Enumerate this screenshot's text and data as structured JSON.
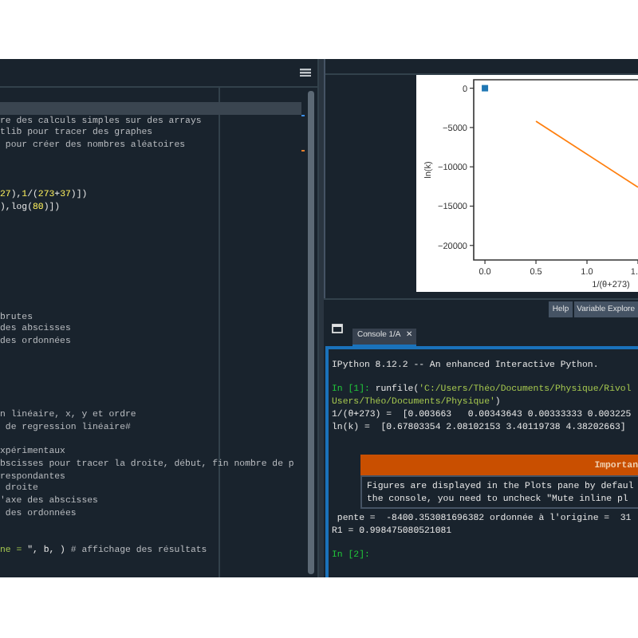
{
  "editor": {
    "lines": [
      {
        "current": true
      },
      {
        "current": false,
        "segments": [
          {
            "text": "re des calculs simples sur des arrays",
            "kind": "comment"
          }
        ]
      },
      {
        "current": false,
        "segments": [
          {
            "text": "tlib pour tracer des graphes",
            "kind": "comment"
          }
        ]
      },
      {
        "current": false,
        "segments": [
          {
            "text": " pour créer des nombres aléatoires",
            "kind": "comment"
          }
        ]
      },
      {
        "current": false
      },
      {
        "current": false
      },
      {
        "current": false
      },
      {
        "current": false,
        "segments": [
          {
            "text": "27",
            "kind": "number"
          },
          {
            "text": "),",
            "kind": "code"
          },
          {
            "text": "1",
            "kind": "number"
          },
          {
            "text": "/(",
            "kind": "code"
          },
          {
            "text": "273",
            "kind": "number"
          },
          {
            "text": "+",
            "kind": "code"
          },
          {
            "text": "37",
            "kind": "number"
          },
          {
            "text": ")])",
            "kind": "code"
          }
        ]
      },
      {
        "current": false,
        "segments": [
          {
            "text": "),log(",
            "kind": "code"
          },
          {
            "text": "80",
            "kind": "number"
          },
          {
            "text": ")])",
            "kind": "code"
          }
        ]
      },
      {
        "current": false
      },
      {
        "current": false
      },
      {
        "current": false
      },
      {
        "current": false
      },
      {
        "current": false
      },
      {
        "current": false
      },
      {
        "current": false
      },
      {
        "current": false
      },
      {
        "current": false,
        "segments": [
          {
            "text": "brutes",
            "kind": "comment"
          }
        ]
      },
      {
        "current": false,
        "segments": [
          {
            "text": "des abscisses",
            "kind": "comment"
          }
        ]
      },
      {
        "current": false,
        "segments": [
          {
            "text": "des ordonnées",
            "kind": "comment"
          }
        ]
      },
      {
        "current": false
      },
      {
        "current": false
      },
      {
        "current": false
      },
      {
        "current": false
      },
      {
        "current": false
      },
      {
        "current": false,
        "segments": [
          {
            "text": "n linéaire, x, y et ordre",
            "kind": "comment"
          }
        ]
      },
      {
        "current": false,
        "segments": [
          {
            "text": " de regression linéaire#",
            "kind": "comment"
          }
        ]
      },
      {
        "current": false
      },
      {
        "current": false,
        "segments": [
          {
            "text": "xpérimentaux",
            "kind": "comment"
          }
        ]
      },
      {
        "current": false,
        "segments": [
          {
            "text": "bscisses pour tracer la droite, début, fin nombre de p",
            "kind": "comment"
          }
        ]
      },
      {
        "current": false,
        "segments": [
          {
            "text": "respondantes",
            "kind": "comment"
          }
        ]
      },
      {
        "current": false,
        "segments": [
          {
            "text": " droite",
            "kind": "comment"
          }
        ]
      },
      {
        "current": false,
        "segments": [
          {
            "text": "'axe des abscisses",
            "kind": "comment"
          }
        ]
      },
      {
        "current": false,
        "segments": [
          {
            "text": " des ordonnées",
            "kind": "comment"
          }
        ]
      },
      {
        "current": false
      },
      {
        "current": false
      },
      {
        "current": false,
        "segments": [
          {
            "text": "ne = ",
            "kind": "string"
          },
          {
            "text": "\", b, ) ",
            "kind": "code"
          },
          {
            "text": "# affichage des résultats",
            "kind": "comment"
          }
        ]
      },
      {
        "current": false
      }
    ]
  },
  "plots": {
    "chart_data": {
      "type": "line",
      "xlabel": "1/(θ+273)",
      "ylabel": "ln(k)",
      "x": [
        0,
        0.5,
        1.5
      ],
      "series": [
        {
          "color": "#1f77b4",
          "marker": "square",
          "values": [
            0,
            null,
            null
          ]
        },
        {
          "color": "#ff7f0e",
          "values": [
            null,
            -4200,
            -12600
          ]
        }
      ],
      "xlim": [
        -0.11,
        1.5
      ],
      "ylim": [
        -21850,
        1075
      ],
      "xticks": [
        {
          "value": 0,
          "label": "0.0"
        },
        {
          "value": 0.5,
          "label": "0.5"
        },
        {
          "value": 1,
          "label": "1.0"
        },
        {
          "value": 1.5,
          "label": "1."
        }
      ],
      "yticks": [
        {
          "value": 0,
          "label": "0"
        },
        {
          "value": -5000,
          "label": "−5000"
        },
        {
          "value": -10000,
          "label": "−10000"
        },
        {
          "value": -15000,
          "label": "−15000"
        },
        {
          "value": -20000,
          "label": "−20000"
        }
      ]
    },
    "pane_tabs": [
      {
        "label": "Help",
        "selected": false
      },
      {
        "label": "Variable Explore",
        "selected": false
      }
    ]
  },
  "console": {
    "tabs": [
      {
        "label": "Console 1/A",
        "selected": true,
        "close": "✕"
      }
    ],
    "output": [
      {
        "kind": "text",
        "segments": [
          {
            "text": "IPython 8.12.2 -- An enhanced Interactive Python.",
            "kind": "code"
          }
        ]
      },
      {
        "kind": "blank"
      },
      {
        "kind": "text",
        "segments": [
          {
            "text": "In [1]: ",
            "kind": "prompt"
          },
          {
            "text": "runfile(",
            "kind": "code"
          },
          {
            "text": "'C:/Users/Théo/Documents/Physique/Rivol",
            "kind": "string"
          }
        ]
      },
      {
        "kind": "text",
        "segments": [
          {
            "text": "Users/Théo/Documents/Physique'",
            "kind": "string"
          },
          {
            "text": ")",
            "kind": "code"
          }
        ]
      },
      {
        "kind": "text",
        "segments": [
          {
            "text": "1/(θ+273) =  [0.003663   0.00343643 0.00333333 0.003225",
            "kind": "code"
          }
        ]
      },
      {
        "kind": "text",
        "segments": [
          {
            "text": "ln(k) =  [0.67803354 2.08102153 3.40119738 4.38202663]",
            "kind": "code"
          }
        ]
      },
      {
        "kind": "blank"
      },
      {
        "kind": "notice",
        "title": "Importan",
        "lines": [
          "Figures are displayed in the Plots pane by defaul",
          "the console, you need to uncheck \"Mute inline pl"
        ]
      },
      {
        "kind": "text",
        "segments": [
          {
            "text": " pente =  -8400.353081696382 ordonnée à l'origine =  31",
            "kind": "code"
          }
        ]
      },
      {
        "kind": "text",
        "segments": [
          {
            "text": "R1 = 0.998475080521081",
            "kind": "code"
          }
        ]
      },
      {
        "kind": "blank"
      },
      {
        "kind": "text",
        "segments": [
          {
            "text": "In [2]: ",
            "kind": "prompt"
          }
        ]
      }
    ]
  }
}
